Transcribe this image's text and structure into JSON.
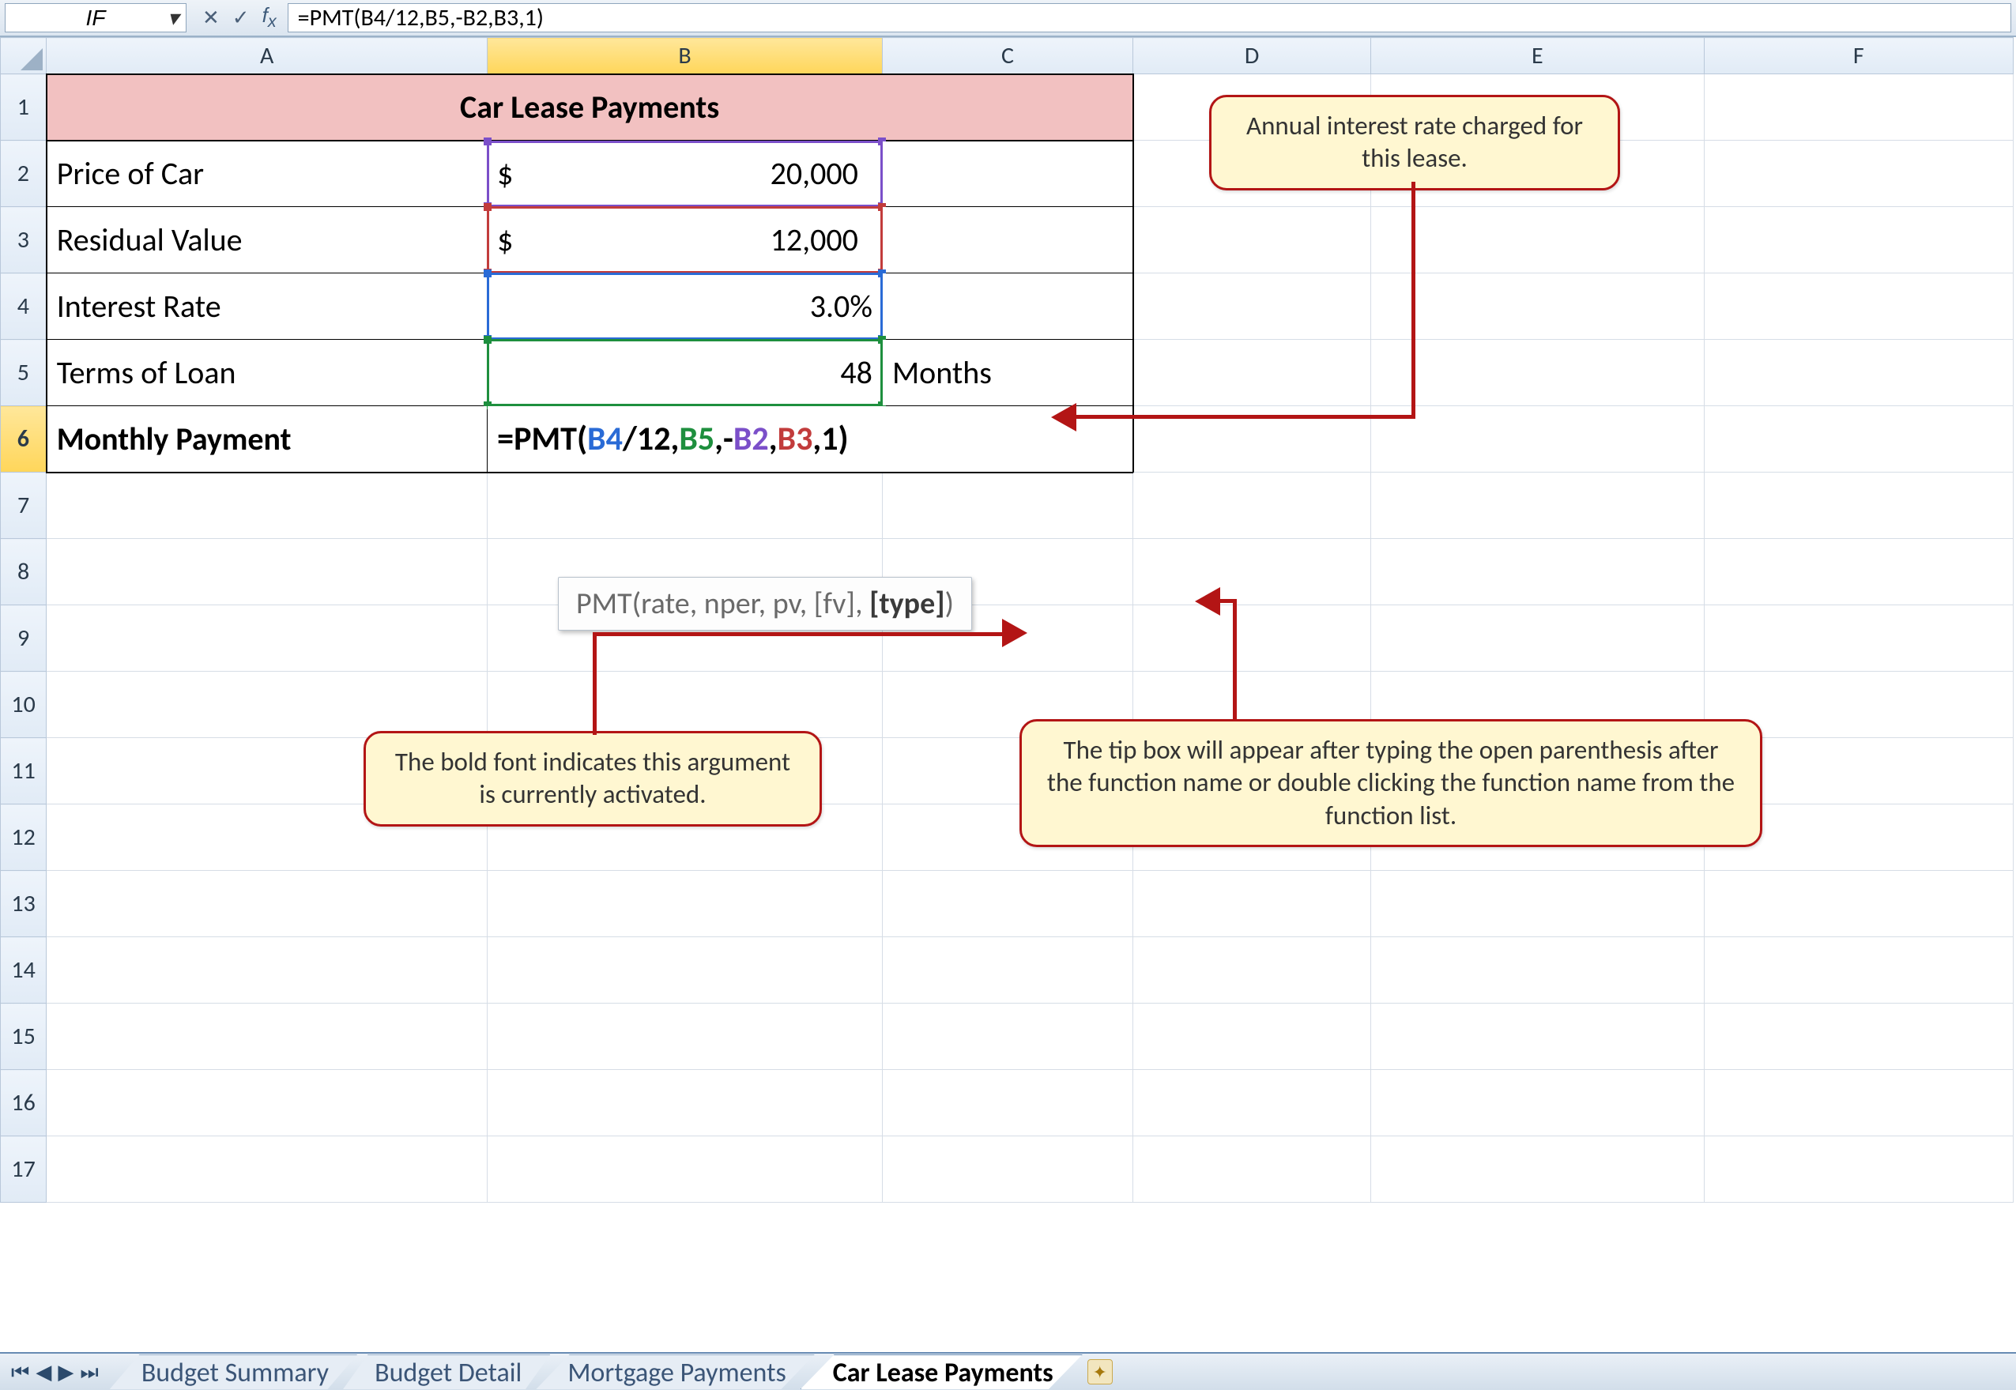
{
  "name_box": "IF",
  "formula_bar": "=PMT(B4/12,B5,-B2,B3,1)",
  "columns": [
    "A",
    "B",
    "C",
    "D",
    "E",
    "F"
  ],
  "rows": [
    "1",
    "2",
    "3",
    "4",
    "5",
    "6",
    "7",
    "8",
    "9",
    "10",
    "11",
    "12",
    "13",
    "14",
    "15",
    "16",
    "17"
  ],
  "title": "Car Lease Payments",
  "labels": {
    "price": "Price of Car",
    "residual": "Residual Value",
    "rate": "Interest Rate",
    "terms": "Terms of Loan",
    "monthly": "Monthly Payment",
    "months": "Months"
  },
  "values": {
    "price": "20,000",
    "residual": "12,000",
    "rate": "3.0%",
    "terms": "48",
    "currency": "$"
  },
  "formula_parts": {
    "p1": "=PMT(",
    "b4": "B4",
    "slash12": "/12,",
    "b5": "B5",
    "comma_neg": ",-",
    "b2": "B2",
    "comma": ",",
    "b3": "B3",
    "tail": ",1)"
  },
  "tooltip": {
    "func": "PMT",
    "open": "(",
    "a1": "rate",
    "a2": "nper",
    "a3": "pv",
    "a4": "[fv]",
    "a5": "[type]",
    "sep": ", ",
    "close": ")"
  },
  "callouts": {
    "c1": "Annual interest rate charged for this lease.",
    "c2": "The bold font indicates this argument is currently activated.",
    "c3": "The tip box will appear after typing the open parenthesis after the function name or double clicking the function name from the function list."
  },
  "tabs": {
    "t1": "Budget Summary",
    "t2": "Budget Detail",
    "t3": "Mortgage Payments",
    "t4": "Car Lease Payments"
  }
}
